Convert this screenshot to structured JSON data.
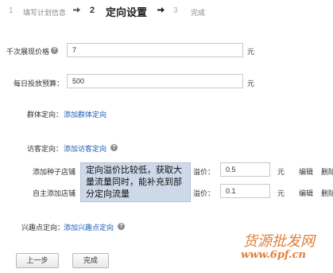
{
  "steps": [
    {
      "number": "1",
      "label": "填写计划信息"
    },
    {
      "number": "2",
      "label": "定向设置"
    },
    {
      "number": "3",
      "label": "完成"
    }
  ],
  "form": {
    "show_price": {
      "label": "千次展现价格",
      "value": "7",
      "unit": "元"
    },
    "daily_budget": {
      "label": "每日投放预算：",
      "value": "500",
      "unit": "元"
    },
    "group_targeting": {
      "label": "群体定向：",
      "link": "添加群体定向"
    },
    "visitor_targeting": {
      "label": "访客定向：",
      "link": "添加访客定向"
    },
    "seed_shop": {
      "label": "添加种子店铺",
      "premium_label": "溢价：",
      "value": "0.5",
      "unit": "元",
      "edit": "编辑",
      "delete": "删除"
    },
    "custom_shop": {
      "label": "自主添加店铺",
      "premium_label": "溢价：",
      "value": "0.1",
      "unit": "元",
      "edit": "编辑",
      "delete": "删除"
    },
    "interest_targeting": {
      "label": "兴趣点定向：",
      "link": "添加兴趣点定向"
    }
  },
  "tooltip": {
    "text": "定向溢价比较低，获取大量流量同时，能补充到部分定向流量"
  },
  "buttons": {
    "prev": "上一步",
    "finish": "完成"
  },
  "watermark": {
    "title": "货源批发网",
    "url": "www.6pf.cn"
  },
  "colors": {
    "link": "#1a5fb4",
    "watermark": "#e07f3a",
    "tooltip_bg": "#cdd8e8"
  }
}
